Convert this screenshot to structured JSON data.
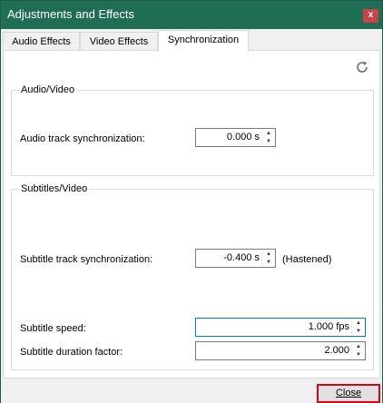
{
  "window": {
    "title": "Adjustments and Effects",
    "close_glyph": "x"
  },
  "tabs": [
    {
      "label": "Audio Effects",
      "active": false
    },
    {
      "label": "Video Effects",
      "active": false
    },
    {
      "label": "Synchronization",
      "active": true
    }
  ],
  "icons": {
    "refresh": "refresh-icon",
    "close": "close-icon"
  },
  "audio_video": {
    "title": "Audio/Video",
    "audio_sync_label": "Audio track synchronization:",
    "audio_sync_value": "0.000 s"
  },
  "subtitles_video": {
    "title": "Subtitles/Video",
    "subtitle_sync_label": "Subtitle track synchronization:",
    "subtitle_sync_value": "-0.400 s",
    "subtitle_sync_note": "(Hastened)",
    "subtitle_speed_label": "Subtitle speed:",
    "subtitle_speed_value": "1.000 fps",
    "subtitle_duration_label": "Subtitle duration factor:",
    "subtitle_duration_value": "2.000"
  },
  "footer": {
    "close_label": "Close"
  },
  "colors": {
    "titlebar": "#1e6d54",
    "highlight_border": "#e0001a",
    "focus_border": "#0078d7"
  }
}
